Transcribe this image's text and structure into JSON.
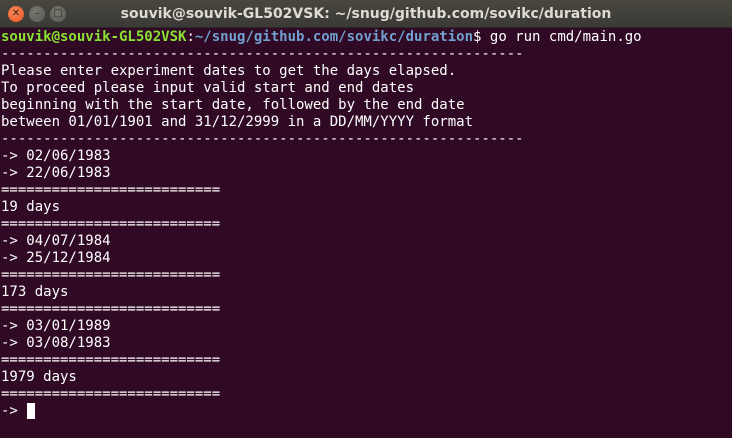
{
  "window": {
    "title": "souvik@souvik-GL502VSK: ~/snug/github.com/sovikc/duration",
    "controls": {
      "close_icon": "close-icon",
      "minimize_icon": "minimize-icon",
      "maximize_icon": "maximize-icon"
    }
  },
  "prompt": {
    "user_host": "souvik@souvik-GL502VSK",
    "separator": ":",
    "path": "~/snug/github.com/sovikc/duration",
    "symbol": "$",
    "command": " go run cmd/main.go"
  },
  "output": {
    "lines": [
      "--------------------------------------------------------------",
      "Please enter experiment dates to get the days elapsed.",
      "To proceed please input valid start and end dates",
      "beginning with the start date, followed by the end date",
      "between 01/01/1901 and 31/12/2999 in a DD/MM/YYYY format",
      "--------------------------------------------------------------",
      "-> 02/06/1983",
      "-> 22/06/1983",
      "==========================",
      "19 days",
      "==========================",
      "-> 04/07/1984",
      "-> 25/12/1984",
      "==========================",
      "173 days",
      "==========================",
      "-> 03/01/1989",
      "-> 03/08/1983",
      "==========================",
      "1979 days",
      "=========================="
    ],
    "input_prompt": "-> "
  },
  "colors": {
    "background": "#300a24",
    "user_host": "#8ae234",
    "path": "#729fcf",
    "text": "#ffffff"
  }
}
